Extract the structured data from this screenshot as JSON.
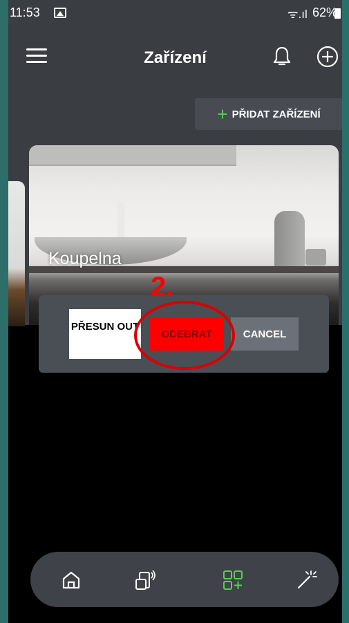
{
  "status_bar": {
    "time": "11:53",
    "wifi": "ᯤ.ıl",
    "battery": "62%"
  },
  "app_bar": {
    "title": "Zařízení",
    "icons": [
      "menu-icon",
      "bell-icon",
      "plus-circle-icon"
    ]
  },
  "add_device_label": "PŘIDAT ZAŘÍZENÍ",
  "room_card": {
    "name": "Koupelna"
  },
  "action_panel": {
    "move_out_label": "PŘESUN OUT",
    "remove_label": "ODEBRAT",
    "cancel_label": "CANCEL"
  },
  "annotation": {
    "step": "2.",
    "color": "#ff0000"
  },
  "bottom_nav": {
    "items": [
      "home-icon",
      "devices-icon",
      "add-devices-icon",
      "scenes-magic-wand-icon"
    ],
    "active_color": "#52d44a"
  }
}
